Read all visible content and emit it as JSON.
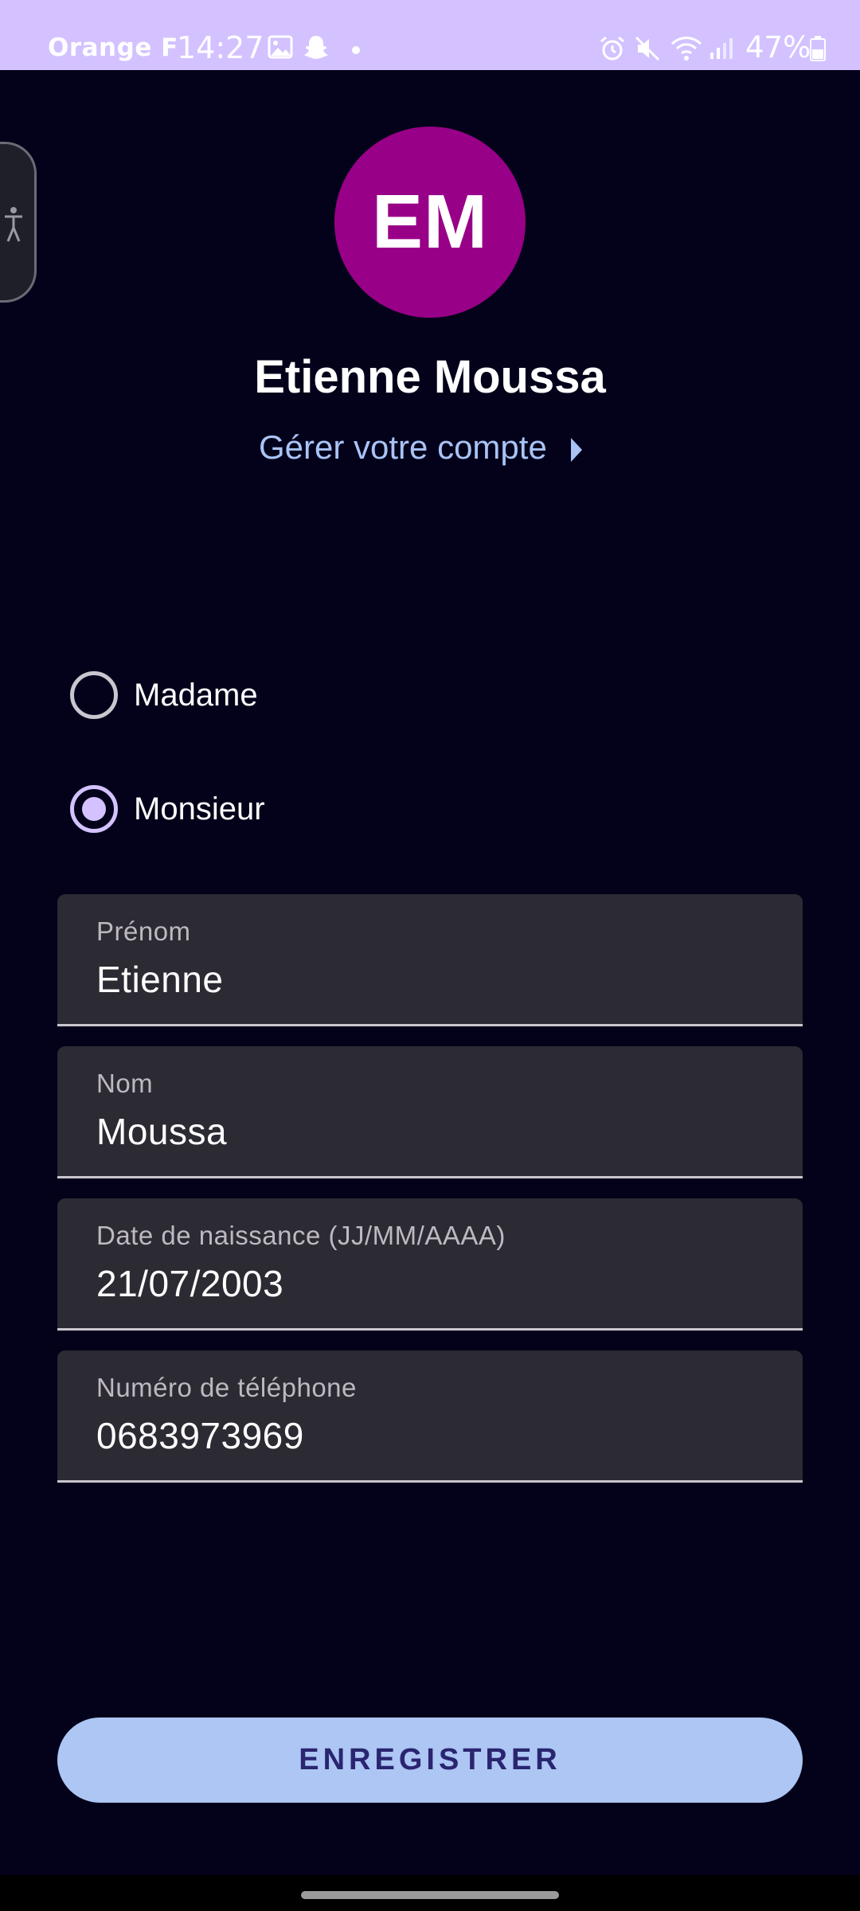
{
  "status_bar": {
    "carrier": "Orange F",
    "time": "14:27",
    "battery": "47%",
    "icons": [
      "gallery-icon",
      "snapchat-icon",
      "dot-icon",
      "alarm-icon",
      "mute-icon",
      "wifi-icon",
      "signal-icon",
      "battery-icon"
    ]
  },
  "accessibility": {
    "icon": "accessibility-icon"
  },
  "profile": {
    "initials": "EM",
    "avatar_color": "#980087",
    "name": "Etienne Moussa",
    "manage_account_label": "Gérer votre compte"
  },
  "civility": {
    "options": [
      {
        "label": "Madame",
        "selected": false
      },
      {
        "label": "Monsieur",
        "selected": true
      }
    ]
  },
  "form": {
    "first_name": {
      "label": "Prénom",
      "value": "Etienne"
    },
    "last_name": {
      "label": "Nom",
      "value": "Moussa"
    },
    "birth_date": {
      "label": "Date de naissance (JJ/MM/AAAA)",
      "value": "21/07/2003"
    },
    "phone": {
      "label": "Numéro de téléphone",
      "value": "0683973969"
    }
  },
  "actions": {
    "save_label": "ENREGISTRER"
  },
  "colors": {
    "background": "#03021a",
    "status_bar": "#d3c2ff",
    "accent": "#d3c2ff",
    "link": "#a9c3f5",
    "button": "#adc6f3",
    "field_background": "#2c2a32"
  }
}
